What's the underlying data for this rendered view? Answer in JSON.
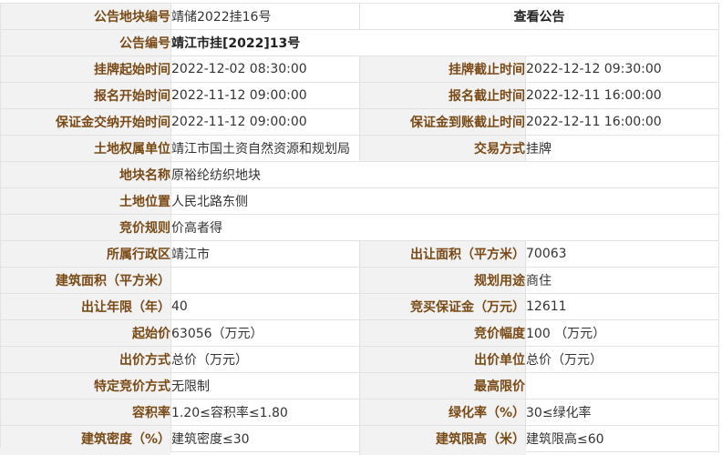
{
  "listing": {
    "plot_number_label": "公告地块编号",
    "plot_number": "靖储2022挂16号",
    "view_notice_link": "查看公告",
    "notice_number_label": "公告编号",
    "notice_number": "靖江市挂[2022]13号",
    "listing_start_label": "挂牌起始时间",
    "listing_start": "2022-12-02 08:30:00",
    "listing_end_label": "挂牌截止时间",
    "listing_end": "2022-12-12 09:30:00",
    "registration_start_label": "报名开始时间",
    "registration_start": "2022-11-12 09:00:00",
    "registration_end_label": "报名截止时间",
    "registration_end": "2022-12-11 16:00:00",
    "deposit_start_label": "保证金交纳开始时间",
    "deposit_start": "2022-11-12 09:00:00",
    "deposit_deadline_label": "保证金到账截止时间",
    "deposit_deadline": "2022-12-11 16:00:00",
    "land_owner_label": "土地权属单位",
    "land_owner": "靖江市国土资自然资源和规划局",
    "trade_method_label": "交易方式",
    "trade_method": "挂牌",
    "plot_name_label": "地块名称",
    "plot_name": "原裕纶纺织地块",
    "location_label": "土地位置",
    "location": "人民北路东侧",
    "bidding_rule_label": "竞价规则",
    "bidding_rule": "价高者得",
    "district_label": "所属行政区",
    "district": "靖江市",
    "transfer_area_label": "出让面积（平方米）",
    "transfer_area": "70063",
    "building_area_label": "建筑面积（平方米）",
    "building_area": "",
    "planned_use_label": "规划用途",
    "planned_use": "商住",
    "transfer_years_label": "出让年限（年）",
    "transfer_years": "40",
    "bid_deposit_label": "竞买保证金（万元）",
    "bid_deposit": "12611",
    "start_price_label": "起始价",
    "start_price": "63056（万元）",
    "bid_increment_label": "竞价幅度",
    "bid_increment": "100 （万元）",
    "price_method_label": "出价方式",
    "price_method": "总价（万元）",
    "price_unit_label": "出价单位",
    "price_unit": "总价（万元）",
    "special_bidding_label": "特定竞价方式",
    "special_bidding": "无限制",
    "max_price_label": "最高限价",
    "max_price": "",
    "plot_ratio_label": "容积率",
    "plot_ratio": "1.20≤容积率≤1.80",
    "green_rate_label": "绿化率（%）",
    "green_rate": "30≤绿化率",
    "building_density_label": "建筑密度（%）",
    "building_density": "建筑密度≤30",
    "height_limit_label": "建筑限高（米）",
    "height_limit": "建筑限高≤60"
  }
}
